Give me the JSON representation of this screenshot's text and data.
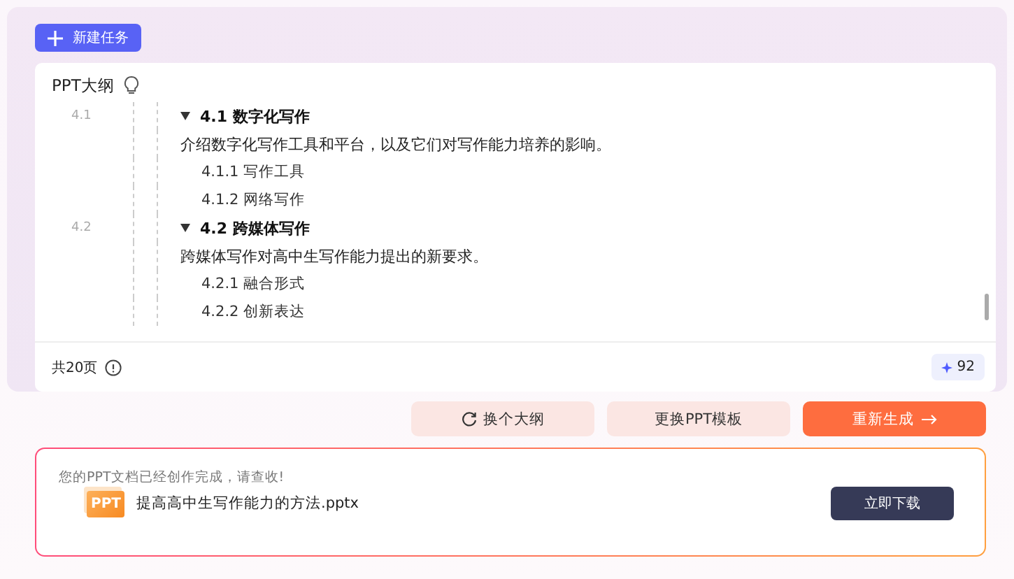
{
  "new_task_button": {
    "label": "新建任务"
  },
  "outline": {
    "title": "PPT大纲",
    "sections": [
      {
        "number": "4.1",
        "title": "4.1 数字化写作",
        "expanded": true,
        "description": "介绍数字化写作工具和平台，以及它们对写作能力培养的影响。",
        "children": [
          {
            "title": "4.1.1 写作工具"
          },
          {
            "title": "4.1.2 网络写作"
          }
        ]
      },
      {
        "number": "4.2",
        "title": "4.2 跨媒体写作",
        "expanded": true,
        "description": "跨媒体写作对高中生写作能力提出的新要求。",
        "children": [
          {
            "title": "4.2.1 融合形式"
          },
          {
            "title": "4.2.2 创新表达"
          }
        ]
      }
    ],
    "page_count": "共20页",
    "credits": "92"
  },
  "actions": [
    {
      "kind": "refresh",
      "label": "换个大纲"
    },
    {
      "kind": "secondary",
      "label": "更换PPT模板"
    },
    {
      "kind": "primary",
      "label": "重新生成"
    }
  ],
  "result": {
    "message": "您的PPT文档已经创作完成，请查收!",
    "file_badge": "PPT",
    "file_name": "提高高中生写作能力的方法.pptx",
    "download_button": "立即下载"
  }
}
